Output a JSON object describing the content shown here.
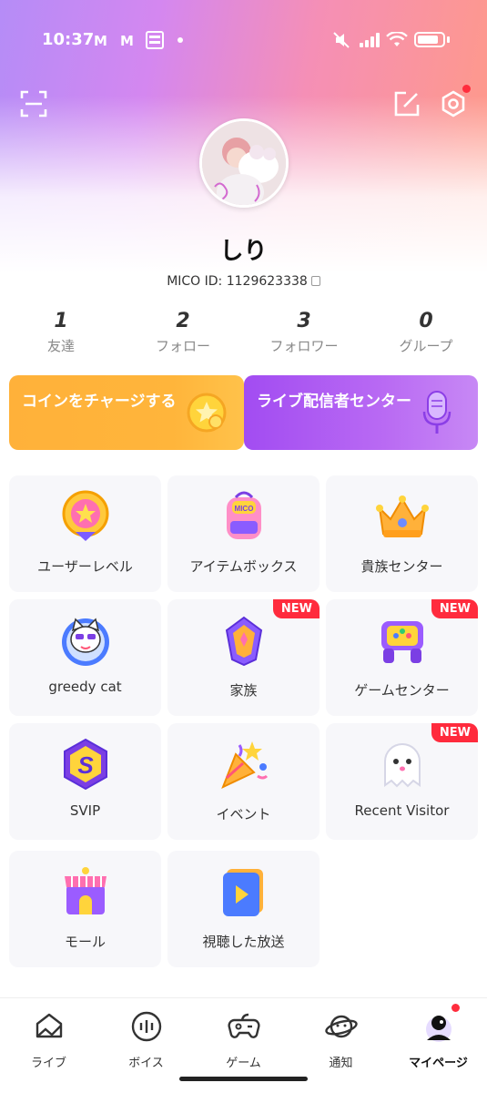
{
  "status_bar": {
    "time": "10:37",
    "notif_icons": [
      "M",
      "M"
    ],
    "battery_percent": 75
  },
  "profile": {
    "username": "しり",
    "mico_id": "MICO ID: 1129623338"
  },
  "stats": [
    {
      "value": "1",
      "label": "友達"
    },
    {
      "value": "2",
      "label": "フォロー"
    },
    {
      "value": "3",
      "label": "フォロワー"
    },
    {
      "value": "0",
      "label": "グループ"
    }
  ],
  "banners": {
    "coin": "コインをチャージする",
    "live": "ライブ配信者センター"
  },
  "grid": {
    "user_level": "ユーザーレベル",
    "item_box": "アイテムボックス",
    "noble_center": "貴族センター",
    "greedy_cat": "greedy cat",
    "family": "家族",
    "game_center": "ゲームセンター",
    "svip": "SVIP",
    "event": "イベント",
    "recent_visitor": "Recent Visitor",
    "mall": "モール",
    "watched": "視聴した放送",
    "new_badge": "NEW",
    "mico_tag": "MICO"
  },
  "nav": [
    {
      "label": "ライブ"
    },
    {
      "label": "ボイス"
    },
    {
      "label": "ゲーム"
    },
    {
      "label": "通知"
    },
    {
      "label": "マイページ"
    }
  ],
  "colors": {
    "accent_red": "#ff2b3d",
    "coin_orange": "#ffb13a",
    "live_purple": "#a24cf2"
  }
}
